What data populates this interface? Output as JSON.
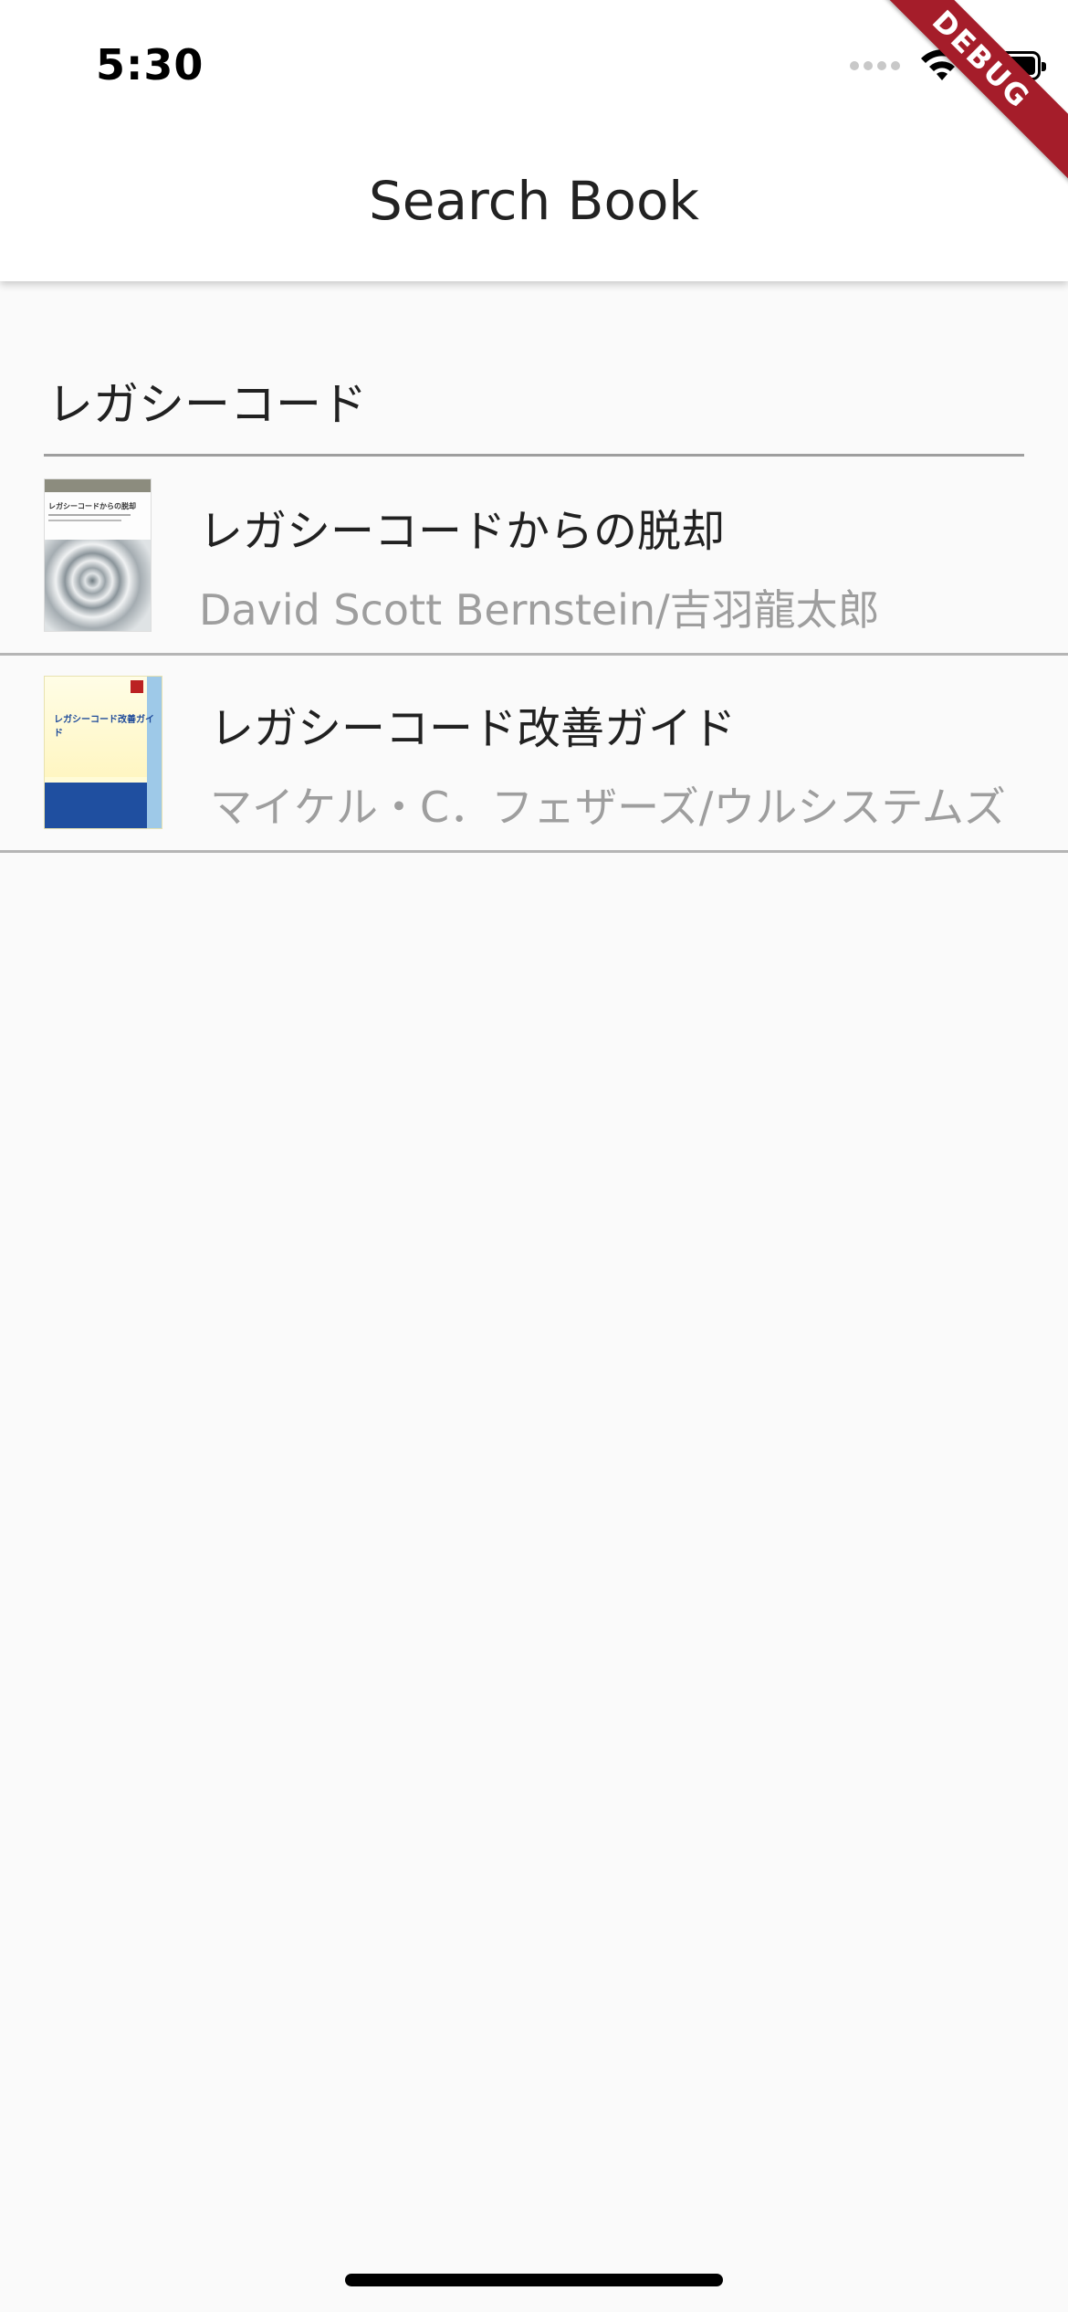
{
  "status_bar": {
    "time": "5:30",
    "icons": [
      "cellular-signal-icon",
      "wifi-icon",
      "battery-icon"
    ]
  },
  "debug_banner": {
    "label": "DEBUG"
  },
  "app_bar": {
    "title": "Search Book"
  },
  "search": {
    "value": "レガシーコード"
  },
  "books": [
    {
      "title": "レガシーコードからの脱却",
      "author": "David Scott Bernstein/吉羽龍太郎",
      "cover_text": "レガシーコードからの脱却"
    },
    {
      "title": "レガシーコード改善ガイド",
      "author": "マイケル・C．フェザーズ/ウルシステムズ",
      "cover_text": "レガシーコード改善ガイド"
    }
  ],
  "colors": {
    "background": "#fafafa",
    "app_bar": "#ffffff",
    "divider": "#b5b5b5",
    "subtitle": "#9e9e9e",
    "debug_ribbon": "#a51d2a"
  }
}
